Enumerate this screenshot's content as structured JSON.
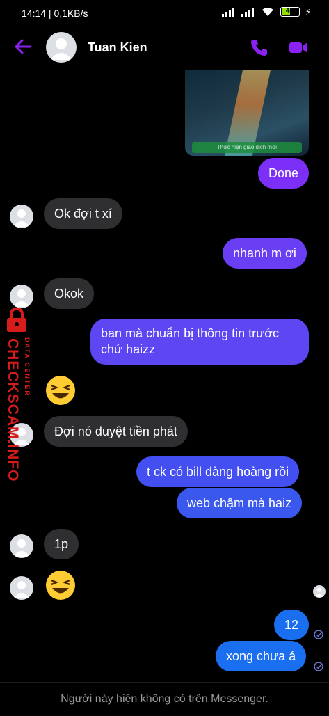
{
  "status_bar": {
    "time": "14:14 | 0,1KB/s",
    "battery": "47"
  },
  "header": {
    "contact_name": "Tuan Kien"
  },
  "preview": {
    "caption": "Thực hiện giao dịch mới"
  },
  "messages": [
    {
      "text": "Done"
    },
    {
      "text": "Ok đợi t xí"
    },
    {
      "text": "nhanh m ơi"
    },
    {
      "text": "Okok"
    },
    {
      "text": "ban mà chuẩn bị thông tin trước"
    },
    {
      "text": "chứ haizz"
    },
    {
      "text": "Đợi nó duyệt tiền phát"
    },
    {
      "text": "t ck có bill dàng hoàng rồi"
    },
    {
      "text": "web chậm mà haiz"
    },
    {
      "text": "1p"
    },
    {
      "text": "12"
    },
    {
      "text": "xong chưa á"
    }
  ],
  "watermark": {
    "big": "CHECKSCAM.INFO",
    "small": "DATA CENTER"
  },
  "footer": {
    "notice": "Người này hiện không có trên Messenger."
  },
  "colors": {
    "accent": "#8a22f2",
    "outgoing_purple": "#7b2ff7",
    "outgoing_blue": "#3a58ee",
    "incoming": "#2f2f31"
  },
  "icons": [
    "back-arrow-icon",
    "phone-icon",
    "video-call-icon",
    "avatar-icon",
    "laughing-emoji-icon",
    "seen-check-icon"
  ]
}
